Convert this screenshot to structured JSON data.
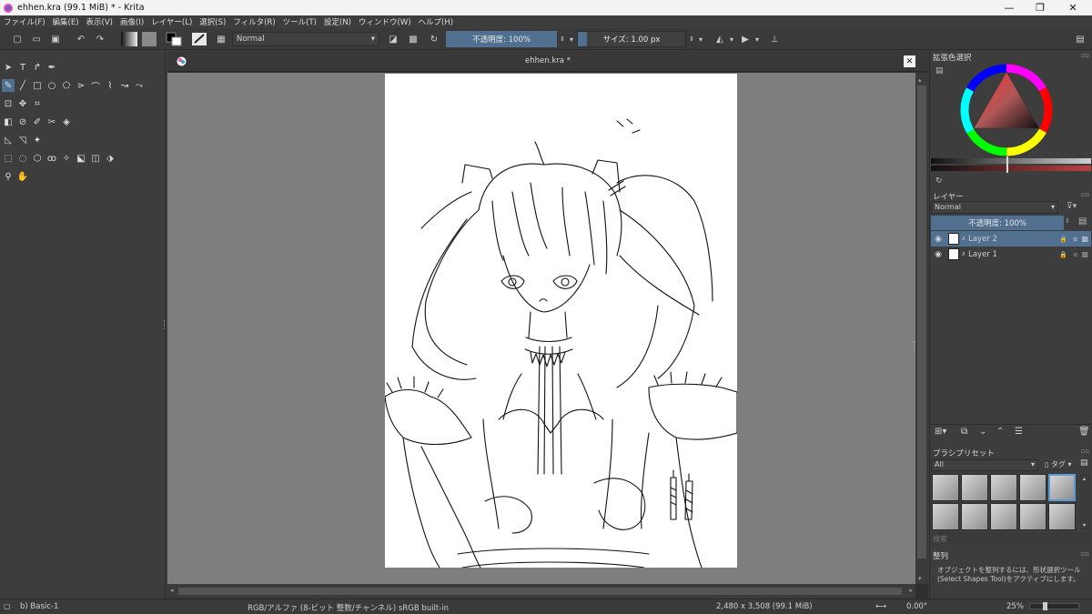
{
  "window": {
    "title": "ehhen.kra (99.1 MiB)  * - Krita"
  },
  "menu": [
    "ファイル(F)",
    "編集(E)",
    "表示(V)",
    "画像(I)",
    "レイヤー(L)",
    "選択(S)",
    "フィルタ(R)",
    "ツール(T)",
    "設定(N)",
    "ウィンドウ(W)",
    "ヘルプ(H)"
  ],
  "toolbar": {
    "blend_mode": "Normal",
    "opacity_label": "不透明度: 100%",
    "size_label": "サイズ: 1.00 px"
  },
  "document": {
    "tab_title": "ehhen.kra *"
  },
  "color_docker": {
    "title": "拡張色選択"
  },
  "layers_docker": {
    "title": "レイヤー",
    "blend_mode": "Normal",
    "opacity_label": "不透明度: 100%",
    "layers": [
      {
        "name": "Layer 2",
        "selected": true
      },
      {
        "name": "Layer 1",
        "selected": false
      }
    ]
  },
  "brush_presets": {
    "title": "ブラシプリセット",
    "filter": "All",
    "tag_label": "タグ",
    "search_placeholder": "検索"
  },
  "arrange_docker": {
    "title": "整列",
    "message": "オブジェクトを整列するには、形状選択ツール (Select Shapes Tool)をアクティブにします。"
  },
  "statusbar": {
    "preset": "b) Basic-1",
    "color_space": "RGB/アルファ (8-ビット 整数/チャンネル)  sRGB built-in",
    "dimensions": "2,480 x 3,508 (99.1 MiB)",
    "rotation": "0.00°",
    "zoom": "25%"
  },
  "colors": {
    "accent": "#51708f",
    "ui_bg": "#3d3d3d",
    "canvas_bg": "#7e7e7e"
  }
}
